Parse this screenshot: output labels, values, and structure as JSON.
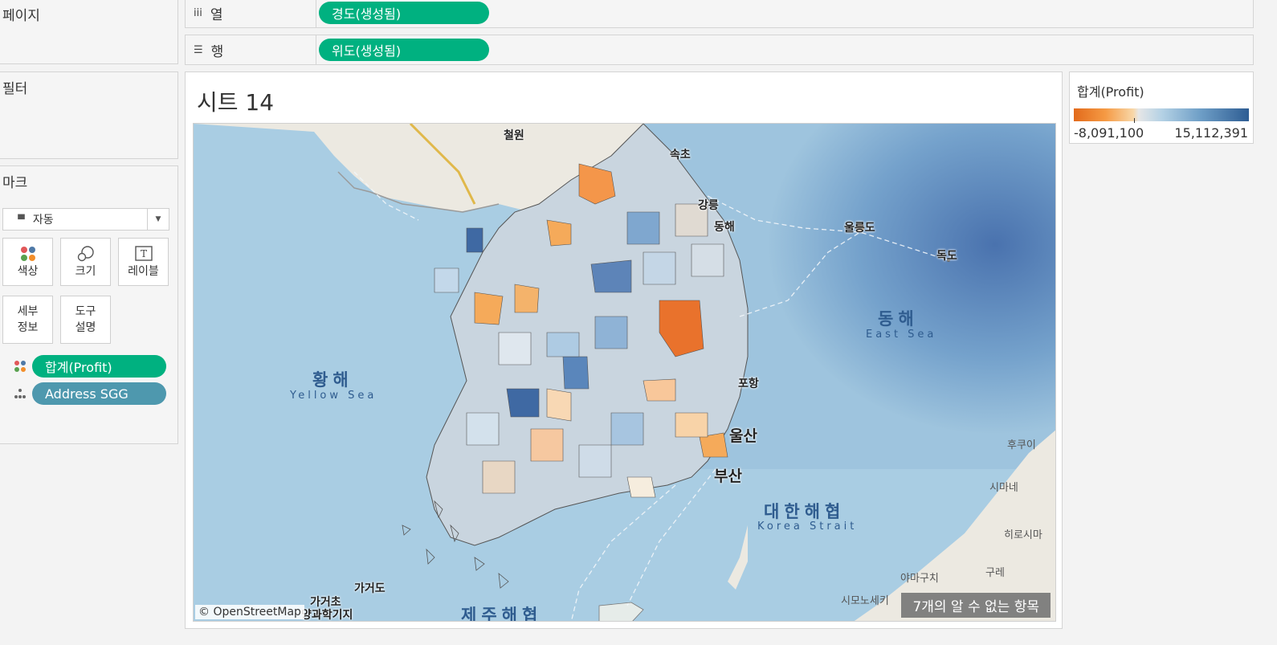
{
  "pages_card": {
    "title": "페이지"
  },
  "filters_card": {
    "title": "필터"
  },
  "columns_shelf": {
    "icon": "iii",
    "label": "열",
    "pill": "경도(생성됨)"
  },
  "rows_shelf": {
    "icon": "☰",
    "label": "행",
    "pill": "위도(생성됨)"
  },
  "marks_card": {
    "title": "마크",
    "mark_type": "자동",
    "buttons": {
      "color": "색상",
      "size": "크기",
      "label": "레이블",
      "detail_l1": "세부",
      "detail_l2": "정보",
      "tooltip_l1": "도구",
      "tooltip_l2": "설명"
    },
    "fields": [
      {
        "label": "합계(Profit)",
        "role": "color"
      },
      {
        "label": "Address SGG",
        "role": "detail"
      }
    ]
  },
  "sheet": {
    "title": "시트 14"
  },
  "map": {
    "seas": {
      "east_kr": "동해",
      "east_en": "East Sea",
      "yellow_kr": "황해",
      "yellow_en": "Yellow Sea",
      "korea_strait_kr": "대한해협",
      "korea_strait_en": "Korea Strait",
      "jeju_strait": "제주해협"
    },
    "cities": {
      "ulsan": "울산",
      "busan": "부산",
      "pohang": "포항",
      "sokcho": "속초",
      "gangneung": "강릉",
      "donghae": "동해",
      "ulleungdo": "울릉도",
      "dokdo": "독도",
      "cheorwon": "철원",
      "gageodo": "가거도",
      "gagyeocho": "가거초",
      "ieodo": "양과학기지"
    },
    "japan": {
      "fukui": "후쿠이",
      "shimane": "시마네",
      "hiroshima": "히로시마",
      "yamaguchi": "야마구치",
      "kure": "구레",
      "shimonoseki": "시모노세키"
    },
    "attribution": "© OpenStreetMap",
    "unknown_items": "7개의 알 수 없는 항목"
  },
  "legend": {
    "title": "합계(Profit)",
    "min": "-8,091,100",
    "max": "15,112,391",
    "min_value": -8091100,
    "max_value": 15112391,
    "colors": {
      "negative": "#e26a1b",
      "mid": "#e6e6e6",
      "positive": "#2e5d93"
    }
  },
  "colors": {
    "pill_green": "#00b180",
    "pill_blue": "#4e98ae"
  }
}
